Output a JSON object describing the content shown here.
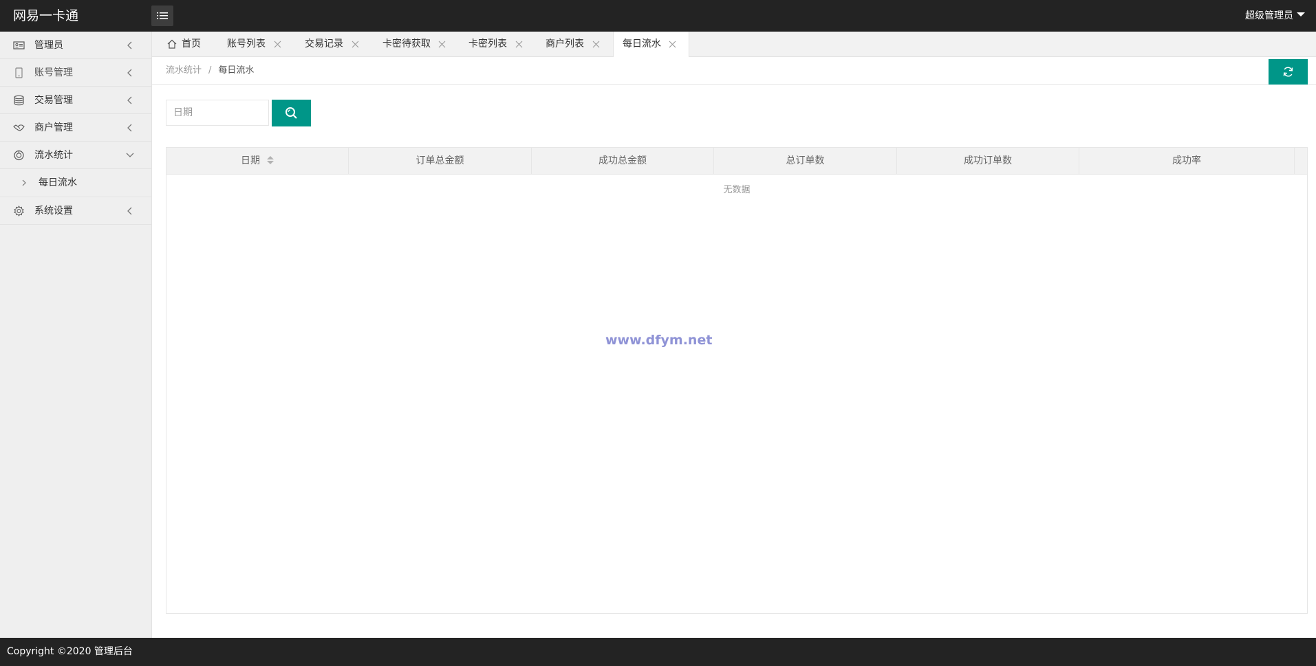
{
  "header": {
    "app_title": "网易一卡通",
    "user_name": "超级管理员"
  },
  "sidebar": {
    "items": [
      {
        "label": "管理员",
        "icon": "id-card-icon"
      },
      {
        "label": "账号管理",
        "icon": "mobile-icon"
      },
      {
        "label": "交易管理",
        "icon": "database-icon"
      },
      {
        "label": "商户管理",
        "icon": "handshake-icon"
      },
      {
        "label": "流水统计",
        "icon": "chart-icon"
      },
      {
        "label": "系统设置",
        "icon": "gear-icon"
      }
    ],
    "sub_items": [
      {
        "label": "每日流水"
      }
    ]
  },
  "tabs": [
    {
      "label": "首页"
    },
    {
      "label": "账号列表"
    },
    {
      "label": "交易记录"
    },
    {
      "label": "卡密待获取"
    },
    {
      "label": "卡密列表"
    },
    {
      "label": "商户列表"
    },
    {
      "label": "每日流水"
    }
  ],
  "breadcrumb": {
    "parent": "流水统计",
    "separator": "/",
    "current": "每日流水"
  },
  "search": {
    "date_placeholder": "日期",
    "date_value": ""
  },
  "table": {
    "columns": [
      "日期",
      "订单总金额",
      "成功总金额",
      "总订单数",
      "成功订单数",
      "成功率"
    ],
    "empty_text": "无数据"
  },
  "watermark": "www.dfym.net",
  "footer": {
    "copyright": "Copyright ©2020 管理后台"
  },
  "colors": {
    "accent": "#009688",
    "header_bg": "#232323",
    "sidebar_bg": "#efefef"
  }
}
